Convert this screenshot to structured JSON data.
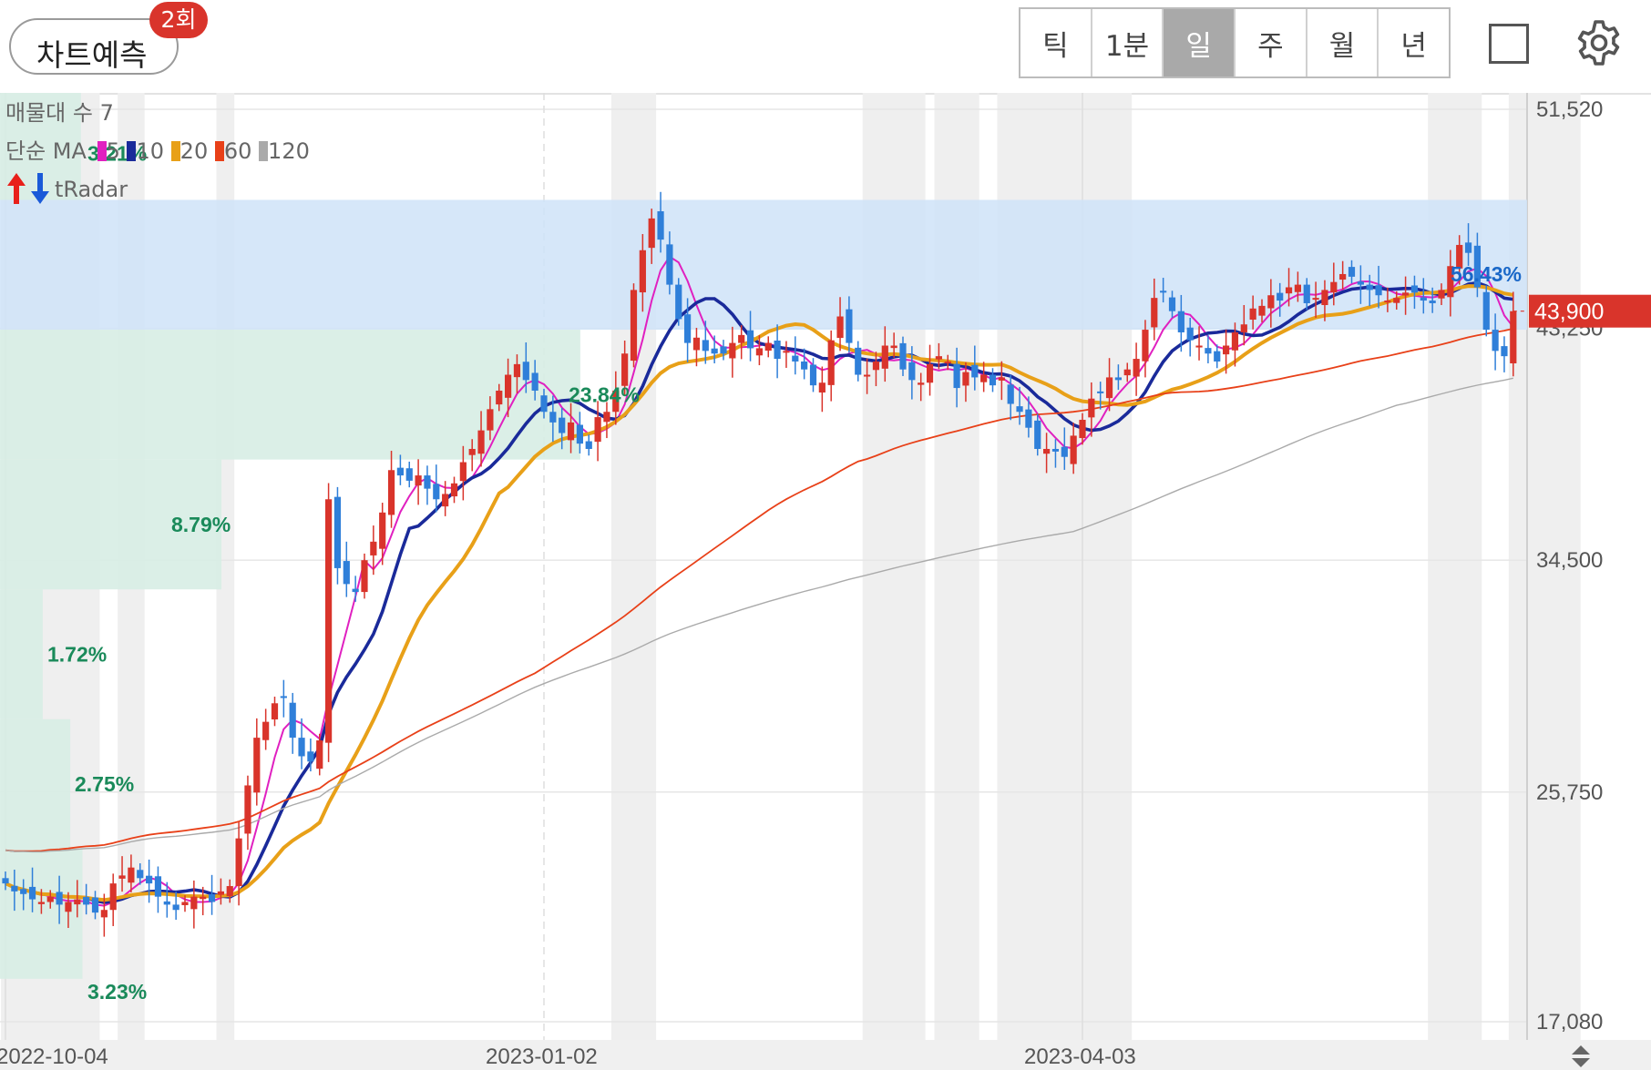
{
  "header": {
    "predict_label": "차트예측",
    "predict_badge": "2회",
    "tabs": [
      {
        "label": "틱",
        "active": false
      },
      {
        "label": "1분",
        "active": false
      },
      {
        "label": "일",
        "active": true
      },
      {
        "label": "주",
        "active": false
      },
      {
        "label": "월",
        "active": false
      },
      {
        "label": "년",
        "active": false
      }
    ],
    "icons": [
      "square-icon",
      "gear-icon"
    ]
  },
  "legend": {
    "volume_profile": "매물대 수 7",
    "ma_label": "단순 MA",
    "ma_periods": [
      "5",
      "10",
      "20",
      "60",
      "120"
    ],
    "ma_colors": [
      "#e020c0",
      "#1a2a9a",
      "#e8a018",
      "#e84018",
      "#aaaaaa"
    ],
    "tradar": "tRadar"
  },
  "colors": {
    "up": "#d9342b",
    "down": "#2f7fd9",
    "price_tag": "#d9342b",
    "profile_green": "#d7ede4",
    "profile_blue": "#cfe3f8",
    "shade": "#efefef"
  },
  "chart_data": {
    "type": "candlestick",
    "ylim": [
      17080,
      51520
    ],
    "y_ticks": [
      "51,520",
      "43,250",
      "34,500",
      "25,750",
      "17,080"
    ],
    "y_tick_values": [
      51520,
      43250,
      34500,
      25750,
      17080
    ],
    "x_tick_labels": [
      "2022-10-04",
      "2023-01-02",
      "2023-04-03"
    ],
    "x_tick_index": [
      0,
      60,
      120
    ],
    "current_price": "43,900",
    "current_price_value": 43900,
    "volume_profile": [
      {
        "low": 43200,
        "high": 48100,
        "pct": "56.43%",
        "extent": 1.0
      },
      {
        "low": 38300,
        "high": 43200,
        "pct": "23.84%",
        "extent": 0.38
      },
      {
        "low": 33400,
        "high": 38300,
        "pct": "8.79%",
        "extent": 0.145
      },
      {
        "low": 28500,
        "high": 33400,
        "pct": "1.72%",
        "extent": 0.028
      },
      {
        "low": 23600,
        "high": 28500,
        "pct": "2.75%",
        "extent": 0.046
      },
      {
        "low": 18700,
        "high": 23600,
        "pct": "3.23%",
        "extent": 0.054
      },
      {
        "low": 48100,
        "high": 53000,
        "pct": "3.21%",
        "extent": 0.053
      }
    ],
    "shaded_ranges": [
      [
        0,
        10
      ],
      [
        13,
        15
      ],
      [
        24,
        25
      ],
      [
        68,
        72
      ],
      [
        96,
        102
      ],
      [
        104,
        108
      ],
      [
        111,
        125
      ],
      [
        159,
        164
      ],
      [
        168,
        175
      ]
    ],
    "closes": [
      22300,
      22000,
      21900,
      21700,
      21600,
      21800,
      21500,
      21600,
      21700,
      21500,
      21200,
      21300,
      22300,
      22600,
      22900,
      22500,
      22300,
      21800,
      21500,
      21300,
      21600,
      21800,
      21800,
      21600,
      22000,
      22200,
      24000,
      26000,
      27800,
      28400,
      29100,
      29300,
      27800,
      27100,
      26900,
      27700,
      36800,
      34200,
      33600,
      33300,
      34500,
      35200,
      36300,
      37900,
      37700,
      37500,
      37700,
      37200,
      36800,
      37000,
      37400,
      38200,
      38700,
      39400,
      40200,
      40900,
      41500,
      41900,
      41300,
      40900,
      40100,
      39700,
      39300,
      39700,
      38900,
      38700,
      39900,
      40100,
      40900,
      42300,
      44700,
      46200,
      47400,
      46600,
      44900,
      43600,
      42700,
      42900,
      42400,
      42300,
      42300,
      42700,
      43000,
      42500,
      42500,
      42700,
      42100,
      42400,
      42000,
      41700,
      41100,
      41200,
      42800,
      43700,
      42700,
      41500,
      41500,
      42000,
      42600,
      42600,
      41700,
      41300,
      41200,
      41900,
      42200,
      42000,
      41000,
      41600,
      41400,
      41500,
      41100,
      41400,
      40400,
      40100,
      39500,
      38700,
      38700,
      38600,
      38400,
      39200,
      39800,
      40600,
      40800,
      41400,
      41300,
      41700,
      42100,
      43200,
      44400,
      44600,
      43900,
      43100,
      42800,
      42600,
      42300,
      42000,
      42600,
      43100,
      43400,
      44000,
      44100,
      44500,
      44300,
      44800,
      44900,
      44200,
      44400,
      44700,
      45000,
      45300,
      45200,
      44900,
      44700,
      44500,
      44300,
      44400,
      44600,
      44600,
      44300,
      44200,
      44700,
      45600,
      46400,
      46100,
      44800,
      43200,
      42400,
      42200,
      43900
    ]
  }
}
